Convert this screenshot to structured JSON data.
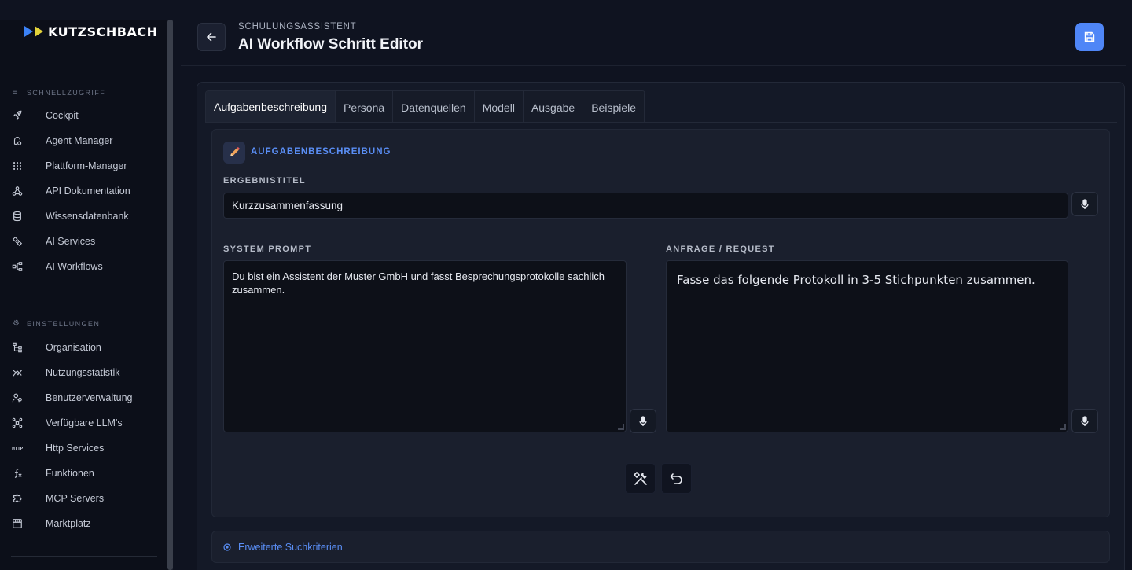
{
  "brand": {
    "name": "KUTZSCHBACH"
  },
  "sidebar": {
    "quick_access_title": "SCHNELLZUGRIFF",
    "quick_items": [
      {
        "label": "Cockpit",
        "icon": "rocket-icon"
      },
      {
        "label": "Agent Manager",
        "icon": "agent-icon"
      },
      {
        "label": "Plattform-Manager",
        "icon": "grid-icon"
      },
      {
        "label": "API Dokumentation",
        "icon": "webhook-icon"
      },
      {
        "label": "Wissensdatenbank",
        "icon": "database-icon"
      },
      {
        "label": "AI Services",
        "icon": "ai-services-icon"
      },
      {
        "label": "AI Workflows",
        "icon": "workflow-icon"
      }
    ],
    "settings_title": "EINSTELLUNGEN",
    "settings_items": [
      {
        "label": "Organisation",
        "icon": "org-icon"
      },
      {
        "label": "Nutzungsstatistik",
        "icon": "chart-icon"
      },
      {
        "label": "Benutzerverwaltung",
        "icon": "users-icon"
      },
      {
        "label": "Verfügbare LLM's",
        "icon": "llm-icon"
      },
      {
        "label": "Http Services",
        "icon": "http-icon"
      },
      {
        "label": "Funktionen",
        "icon": "function-icon"
      },
      {
        "label": "MCP Servers",
        "icon": "puzzle-icon"
      },
      {
        "label": "Marktplatz",
        "icon": "store-icon"
      }
    ]
  },
  "header": {
    "breadcrumb": "SCHULUNGSASSISTENT",
    "title": "AI Workflow Schritt Editor"
  },
  "tabs": [
    {
      "label": "Aufgabenbeschreibung",
      "active": true
    },
    {
      "label": "Persona",
      "active": false
    },
    {
      "label": "Datenquellen",
      "active": false
    },
    {
      "label": "Modell",
      "active": false
    },
    {
      "label": "Ausgabe",
      "active": false
    },
    {
      "label": "Beispiele",
      "active": false
    }
  ],
  "task_card": {
    "title": "AUFGABENBESCHREIBUNG",
    "result_title_label": "ERGEBNISTITEL",
    "result_title_value": "Kurzzusammenfassung",
    "system_prompt_label": "SYSTEM PROMPT",
    "system_prompt_value": "Du bist ein Assistent der Muster GmbH und fasst Besprechungsprotokolle sachlich zusammen.",
    "request_label": "ANFRAGE / REQUEST",
    "request_value": "Fasse das folgende Protokoll in 3-5 Stichpunkten zusammen."
  },
  "advanced": {
    "label": "Erweiterte Suchkriterien"
  },
  "colors": {
    "accent": "#4f86f7",
    "background": "#0f1320",
    "sidebar": "#0c0f19"
  }
}
